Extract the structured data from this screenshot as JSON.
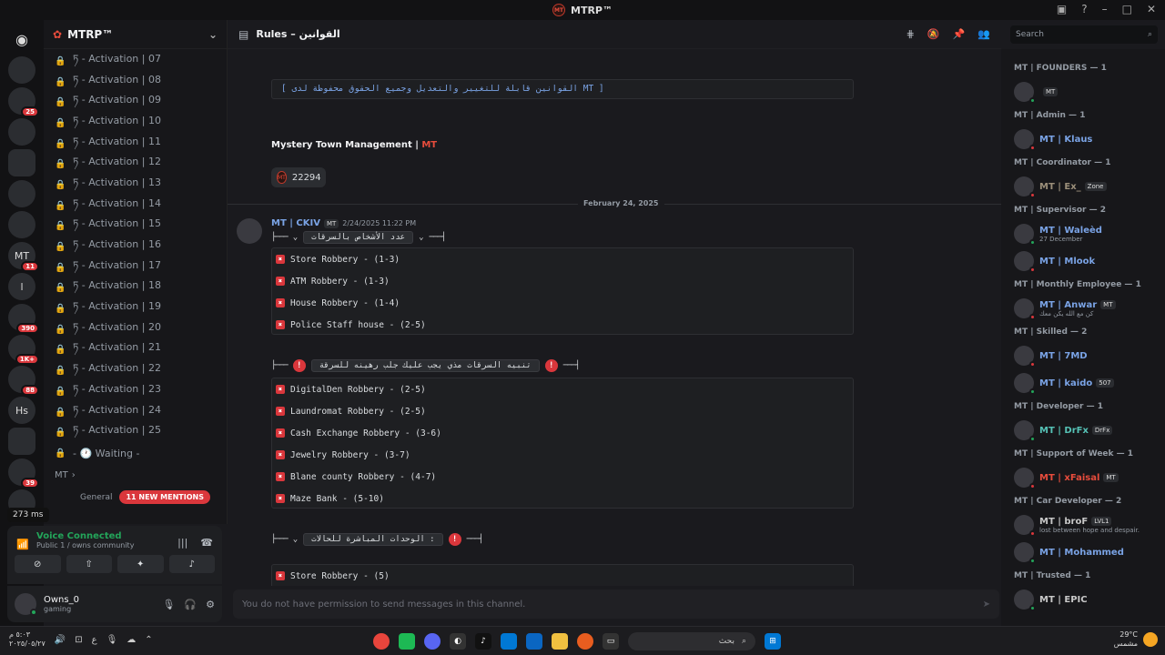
{
  "window": {
    "title": "MTRP™"
  },
  "guilds": [
    {
      "label": "",
      "badge": ""
    },
    {
      "label": "",
      "badge": "25"
    },
    {
      "label": "",
      "badge": ""
    },
    {
      "label": "",
      "badge": ""
    },
    {
      "label": "",
      "badge": ""
    },
    {
      "label": "",
      "badge": ""
    },
    {
      "label": "MT",
      "badge": "11"
    },
    {
      "label": "l",
      "badge": ""
    },
    {
      "label": "",
      "badge": "390"
    },
    {
      "label": "",
      "badge": "1K+"
    },
    {
      "label": "",
      "badge": "88"
    },
    {
      "label": "Hs",
      "badge": ""
    },
    {
      "label": "",
      "badge": ""
    },
    {
      "label": "",
      "badge": "39"
    },
    {
      "label": "",
      "badge": ""
    }
  ],
  "sidebar": {
    "server_name": "MTRP™",
    "channels": [
      "ཏ - Activation | 07",
      "ཏ - Activation | 08",
      "ཏ - Activation | 09",
      "ཏ - Activation | 10",
      "ཏ - Activation | 11",
      "ཏ - Activation | 12",
      "ཏ - Activation | 13",
      "ཏ - Activation | 14",
      "ཏ - Activation | 15",
      "ཏ - Activation | 16",
      "ཏ - Activation | 17",
      "ཏ - Activation | 18",
      "ཏ - Activation | 19",
      "ཏ - Activation | 20",
      "ཏ - Activation | 21",
      "ཏ - Activation | 22",
      "ཏ - Activation | 23",
      "ཏ - Activation | 24",
      "ཏ - Activation | 25",
      "- 🕐 Waiting -"
    ],
    "category_mt": "MT",
    "category_general": "General",
    "mentions": "11 NEW MENTIONS"
  },
  "ping": "273 ms",
  "voice": {
    "status": "Voice Connected",
    "location": "Public 1 / owns community"
  },
  "user": {
    "name": "Owns_0",
    "status": "gaming"
  },
  "channel": {
    "name": "Rules – القوانين"
  },
  "search": {
    "placeholder": "Search"
  },
  "messages": {
    "notice": "[ القوانين قابلة للتغيير والتعديل وجميع الحقوق محفوظة لدى MT ]",
    "mgmt_name": "Mystery Town Management |",
    "mgmt_tag": "MT",
    "reaction_count": "22294",
    "date_separator": "February 24, 2025",
    "author": "MT | CKIV",
    "author_tag": "MT",
    "timestamp": "2/24/2025 11:22 PM",
    "heading1": "عدد الأشخاص بالسرقات",
    "list1": [
      "Store Robbery - (1-3)",
      "ATM Robbery - (1-3)",
      "House Robbery - (1-4)",
      "Police Staff house - (2-5)"
    ],
    "heading2": "تنبيه السرقات مذي يجب عليك جلب رهينه للسرقة",
    "list2": [
      "DigitalDen Robbery - (2-5)",
      "Laundromat Robbery - (2-5)",
      "Cash Exchange Robbery - (3-6)",
      "Jewelry Robbery  - (3-7)",
      "Blane county Robbery - (4-7)",
      "Maze Bank - (5-10)"
    ],
    "heading3": "الوحدات المباشرة للحالات :",
    "list3": [
      "Store Robbery - (5)"
    ]
  },
  "composer": {
    "placeholder": "You do not have permission to send messages in this channel."
  },
  "members": {
    "groups": [
      {
        "role": "MT | FOUNDERS — 1",
        "members": [
          {
            "name": "",
            "sub": "",
            "tag": "MT",
            "color": "#8e2a2a"
          }
        ]
      },
      {
        "role": "MT | Admin — 1",
        "members": [
          {
            "name": "MT | Klaus",
            "sub": "",
            "tag": "",
            "color": "#7aa3e5"
          }
        ]
      },
      {
        "role": "MT | Coordinator — 1",
        "members": [
          {
            "name": "MT | Ex_",
            "sub": "",
            "tag": "Zone",
            "color": "#9b8f7a"
          }
        ]
      },
      {
        "role": "MT | Supervisor — 2",
        "members": [
          {
            "name": "MT | Waleèd",
            "sub": "27 December",
            "tag": "",
            "color": "#7aa3e5"
          },
          {
            "name": "MT | Mlook",
            "sub": "",
            "tag": "",
            "color": "#7aa3e5"
          }
        ]
      },
      {
        "role": "MT | Monthly Employee — 1",
        "members": [
          {
            "name": "MT | Anwar",
            "sub": "كن مع الله يكن معك",
            "tag": "MT",
            "color": "#7aa3e5"
          }
        ]
      },
      {
        "role": "MT | Skilled — 2",
        "members": [
          {
            "name": "MT | 7MD",
            "sub": "",
            "tag": "",
            "color": "#7aa3e5"
          },
          {
            "name": "MT | kaido",
            "sub": "",
            "tag": "507",
            "color": "#7aa3e5"
          }
        ]
      },
      {
        "role": "MT | Developer — 1",
        "members": [
          {
            "name": "MT | DrFx",
            "sub": "",
            "tag": "DrFx",
            "color": "#56c2b6"
          }
        ]
      },
      {
        "role": "MT | Support of Week — 1",
        "members": [
          {
            "name": "MT | xFaisal",
            "sub": "",
            "tag": "MT",
            "color": "#e74c3c"
          }
        ]
      },
      {
        "role": "MT | Car Developer — 2",
        "members": [
          {
            "name": "MT | broF",
            "sub": "lost between hope and despair.",
            "tag": "LVL1",
            "color": "#c8c8c8"
          },
          {
            "name": "MT | Mohammed",
            "sub": "",
            "tag": "",
            "color": "#7aa3e5"
          }
        ]
      },
      {
        "role": "MT | Trusted — 1",
        "members": [
          {
            "name": "MT | EPIC",
            "sub": "",
            "tag": "",
            "color": "#c8c8c8"
          }
        ]
      }
    ]
  },
  "taskbar": {
    "clock_time": "٥:٠٣ م",
    "clock_date": "٢٠٢٥/٠٥/٢٧",
    "search_label": "بحث",
    "weather_temp": "29°C",
    "weather_desc": "مشمس"
  }
}
